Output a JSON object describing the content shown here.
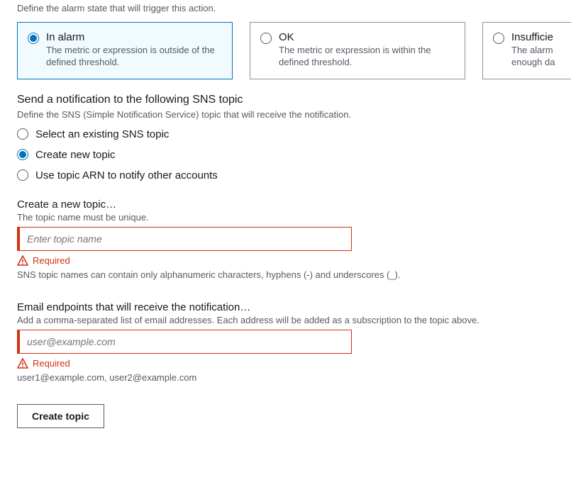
{
  "alarm_state": {
    "hint": "Define the alarm state that will trigger this action.",
    "cards": [
      {
        "title": "In alarm",
        "desc": "The metric or expression is outside of the defined threshold."
      },
      {
        "title": "OK",
        "desc": "The metric or expression is within the defined threshold."
      },
      {
        "title": "Insufficie",
        "desc_line1": "The alarm",
        "desc_line2": "enough da"
      }
    ]
  },
  "sns_section": {
    "heading": "Send a notification to the following SNS topic",
    "hint": "Define the SNS (Simple Notification Service) topic that will receive the notification.",
    "options": [
      "Select an existing SNS topic",
      "Create new topic",
      "Use topic ARN to notify other accounts"
    ]
  },
  "topic_field": {
    "label": "Create a new topic…",
    "hint": "The topic name must be unique.",
    "placeholder": "Enter topic name",
    "error": "Required",
    "helper": "SNS topic names can contain only alphanumeric characters, hyphens (-) and underscores (_)."
  },
  "email_field": {
    "label": "Email endpoints that will receive the notification…",
    "hint": "Add a comma-separated list of email addresses. Each address will be added as a subscription to the topic above.",
    "placeholder": "user@example.com",
    "error": "Required",
    "helper": "user1@example.com, user2@example.com"
  },
  "create_button": "Create topic"
}
